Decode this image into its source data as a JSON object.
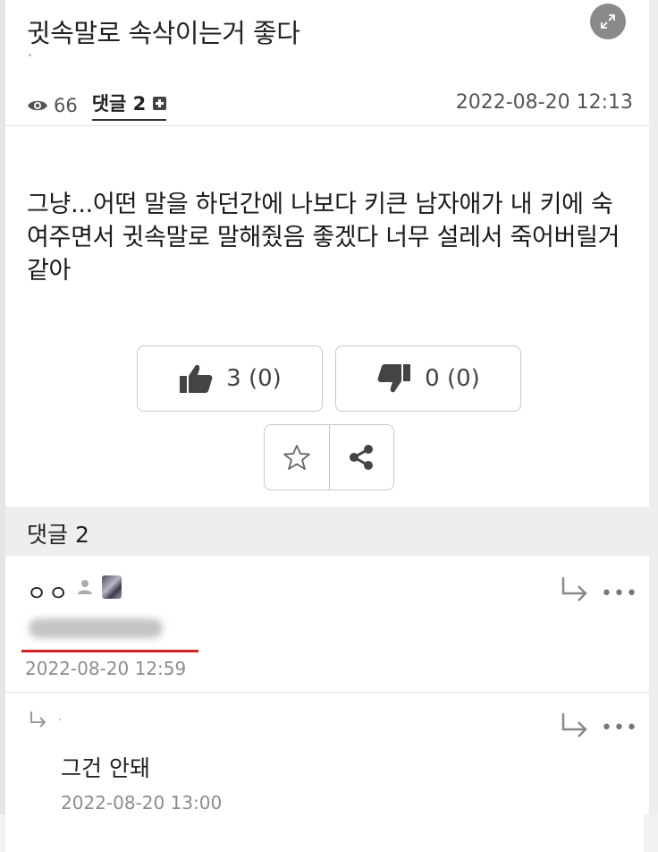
{
  "post": {
    "title": "귓속말로 속삭이는거 좋다",
    "views": "66",
    "comment_link_label": "댓글 2",
    "date": "2022-08-20 12:13",
    "body": "그냥...어떤 말을 하던간에 나보다 키큰 남자애가 내 키에 숙여주면서 귓속말로 말해줬음 좋겠다 너무 설레서 죽어버릴거같아"
  },
  "votes": {
    "up_label": "3 (0)",
    "down_label": "0 (0)"
  },
  "comments": {
    "header": "댓글 2",
    "items": [
      {
        "author": "ㅇㅇ",
        "text": "",
        "date": "2022-08-20 12:59"
      },
      {
        "author": "",
        "text": "그건 안돼",
        "date": "2022-08-20 13:00"
      }
    ]
  },
  "icons": {
    "expand": "expand-icon",
    "eye": "eye-icon",
    "thumbs_up": "thumbs-up-icon",
    "thumbs_down": "thumbs-down-icon",
    "star": "star-icon",
    "share": "share-icon",
    "reply": "reply-arrow-icon",
    "more": "more-icon",
    "user": "user-icon"
  },
  "colors": {
    "highlight_underline": "#d42020",
    "section_header_bg": "#eeeeee"
  }
}
